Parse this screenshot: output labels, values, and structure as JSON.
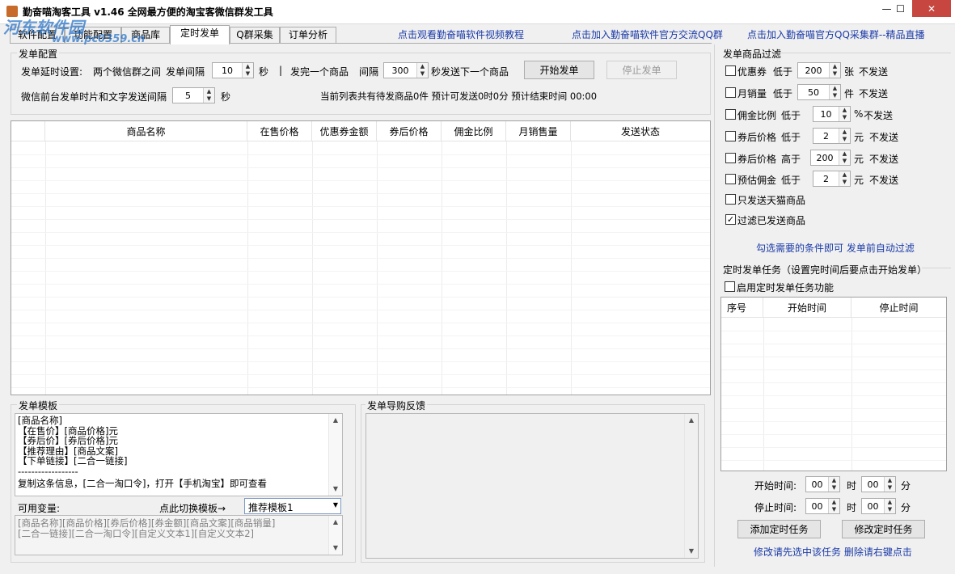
{
  "window": {
    "title": "勤奋喵淘客工具 v1.46  全网最方便的淘宝客微信群发工具",
    "btn_min": "—",
    "btn_max": "☐",
    "btn_close": "✕"
  },
  "watermark": {
    "text": "河东软件园",
    "url": "www.pc0359.cn"
  },
  "tabs": [
    "软件配置",
    "功能配置",
    "商品库",
    "定时发单",
    "Q群采集",
    "订单分析"
  ],
  "top_links": [
    "点击观看勤奋喵软件视频教程",
    "点击加入勤奋喵软件官方交流QQ群",
    "点击加入勤奋喵官方QQ采集群--精品直播"
  ],
  "send_config": {
    "title": "发单配置",
    "delay_label": "发单延时设置:",
    "between_groups": "两个微信群之间",
    "interval_label": "发单间隔",
    "interval_value": "10",
    "sec1": "秒",
    "sep": "|",
    "after_one": "发完一个商品",
    "gap_label": "间隔",
    "gap_value": "300",
    "gap_suffix": "秒发送下一个商品",
    "start_btn": "开始发单",
    "stop_btn": "停止发单",
    "img_text_label": "微信前台发单时片和文字发送间隔",
    "img_text_value": "5",
    "sec2": "秒",
    "status": "当前列表共有待发商品0件  预计可发送0时0分  预计结束时间 00:00"
  },
  "table": {
    "columns": [
      "",
      "商品名称",
      "在售价格",
      "优惠券金额",
      "券后价格",
      "佣金比例",
      "月销售量",
      "发送状态"
    ]
  },
  "template": {
    "title": "发单模板",
    "lines": [
      "[商品名称]",
      "【在售价】[商品价格]元",
      "【券后价】[券后价格]元",
      "【推荐理由】[商品文案]",
      "【下单链接】[二合一链接]",
      "------------------",
      "复制这条信息，[二合一淘口令]，打开【手机淘宝】即可查看"
    ],
    "vars_label": "可用变量:",
    "switch_label": "点此切换模板→",
    "switch_value": "推荐模板1",
    "vars_lines": [
      "[商品名称][商品价格][券后价格][券金额][商品文案][商品销量]",
      "[二合一链接][二合一淘口令][自定义文本1][自定义文本2]"
    ]
  },
  "feedback": {
    "title": "发单导购反馈"
  },
  "filter": {
    "title": "发单商品过滤",
    "rows": [
      {
        "label": "优惠券",
        "cond": "低于",
        "value": "200",
        "unit": "张",
        "suffix": "不发送",
        "checked": false
      },
      {
        "label": "月销量",
        "cond": "低于",
        "value": "50",
        "unit": "件",
        "suffix": "不发送",
        "checked": false
      },
      {
        "label": "佣金比例",
        "cond": "低于",
        "value": "10",
        "unit": "%",
        "suffix": "不发送",
        "checked": false
      },
      {
        "label": "券后价格",
        "cond": "低于",
        "value": "2",
        "unit": "元",
        "suffix": "不发送",
        "checked": false
      },
      {
        "label": "券后价格",
        "cond": "高于",
        "value": "200",
        "unit": "元",
        "suffix": "不发送",
        "checked": false
      },
      {
        "label": "预估佣金",
        "cond": "低于",
        "value": "2",
        "unit": "元",
        "suffix": "不发送",
        "checked": false
      }
    ],
    "tmall_only": "只发送天猫商品",
    "filter_sent": "过滤已发送商品",
    "hint": "勾选需要的条件即可  发单前自动过滤"
  },
  "schedule": {
    "title": "定时发单任务（设置完时间后要点击开始发单）",
    "enable_label": "启用定时发单任务功能",
    "columns": [
      "序号",
      "开始时间",
      "停止时间"
    ],
    "start_label": "开始时间:",
    "stop_label": "停止时间:",
    "hour_unit": "时",
    "min_unit": "分",
    "start_h": "00",
    "start_m": "00",
    "stop_h": "00",
    "stop_m": "00",
    "add_btn": "添加定时任务",
    "edit_btn": "修改定时任务",
    "hint": "修改请先选中该任务  删除请右键点击"
  },
  "icons": {
    "spin_up": "▲",
    "spin_down": "▼",
    "scroll_up": "▲",
    "scroll_down": "▼",
    "dropdown": "▼",
    "check": "✓"
  }
}
